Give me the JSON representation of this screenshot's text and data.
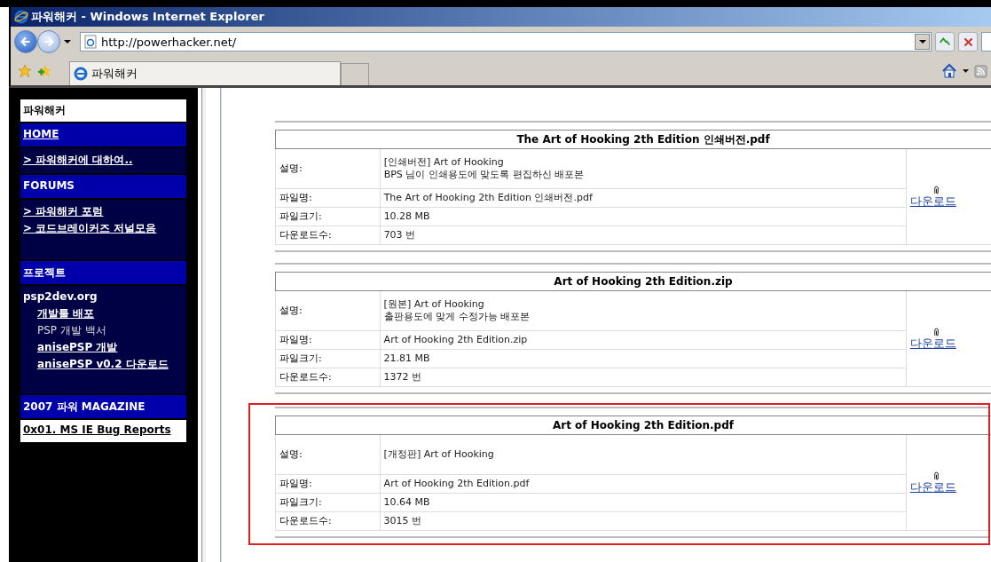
{
  "window": {
    "title": "파워해커 - Windows Internet Explorer"
  },
  "address_bar": {
    "url": "http://powerhacker.net/"
  },
  "tabs": [
    {
      "label": "파워해커",
      "selected": true
    }
  ],
  "sidebar": [
    {
      "kind": "title",
      "text": "파워해커"
    },
    {
      "kind": "header-link",
      "text": "HOME"
    },
    {
      "kind": "links",
      "items": [
        {
          "kind": "link",
          "text": "> 파워해커에 대하여.."
        }
      ]
    },
    {
      "kind": "header",
      "text": "FORUMS"
    },
    {
      "kind": "links",
      "items": [
        {
          "kind": "link",
          "text": "> 파워해커 포럼"
        },
        {
          "kind": "link",
          "text": "> 코드브레이커즈 저널모음"
        }
      ]
    },
    {
      "kind": "header",
      "text": "프로젝트"
    },
    {
      "kind": "links",
      "label": "psp2dev.org",
      "items": [
        {
          "kind": "link",
          "text": "개발툴 배포"
        },
        {
          "kind": "plain",
          "text": "PSP 개발 백서"
        },
        {
          "kind": "link",
          "text": "anisePSP 개발"
        },
        {
          "kind": "link",
          "text": "anisePSP v0.2 다운로드"
        }
      ]
    },
    {
      "kind": "header",
      "text": "2007 파워 MAGAZINE"
    },
    {
      "kind": "title-link",
      "text": "0x01. MS IE Bug Reports"
    }
  ],
  "files": [
    {
      "title": "The Art of Hooking 2th Edition 인쇄버전.pdf",
      "highlighted": false,
      "download": "다운로드",
      "fields": [
        {
          "label": "설명:",
          "lines": [
            "[인쇄버전] Art of Hooking",
            "BPS 님이 인쇄용도에 맞도록 편집하신 배포본"
          ]
        },
        {
          "label": "파일명:",
          "lines": [
            "The Art of Hooking 2th Edition 인쇄버전.pdf"
          ]
        },
        {
          "label": "파일크기:",
          "lines": [
            "10.28 MB"
          ]
        },
        {
          "label": "다운로드수:",
          "lines": [
            "703 번"
          ]
        }
      ]
    },
    {
      "title": "Art of Hooking 2th Edition.zip",
      "highlighted": false,
      "download": "다운로드",
      "fields": [
        {
          "label": "설명:",
          "lines": [
            "[원본] Art of Hooking",
            "출판용도에 맞게 수정가능 배포본"
          ]
        },
        {
          "label": "파일명:",
          "lines": [
            "Art of Hooking 2th Edition.zip"
          ]
        },
        {
          "label": "파일크기:",
          "lines": [
            "21.81 MB"
          ]
        },
        {
          "label": "다운로드수:",
          "lines": [
            "1372 번"
          ]
        }
      ]
    },
    {
      "title": "Art of Hooking 2th Edition.pdf",
      "highlighted": true,
      "download": "다운로드",
      "fields": [
        {
          "label": "설명:",
          "lines": [
            "[개정판] Art of Hooking"
          ]
        },
        {
          "label": "파일명:",
          "lines": [
            "Art of Hooking 2th Edition.pdf"
          ]
        },
        {
          "label": "파일크기:",
          "lines": [
            "10.64 MB"
          ]
        },
        {
          "label": "다운로드수:",
          "lines": [
            "3015 번"
          ]
        }
      ]
    }
  ]
}
